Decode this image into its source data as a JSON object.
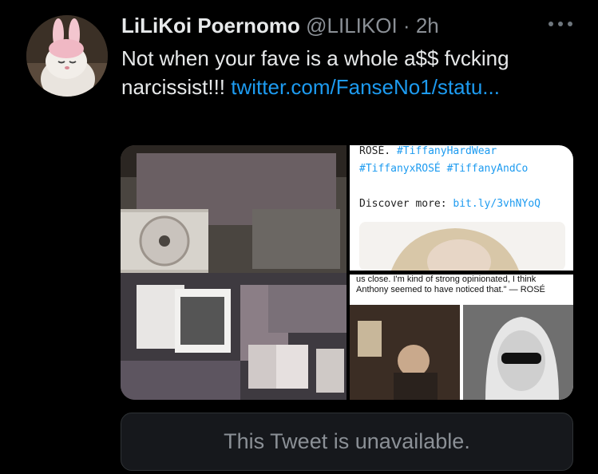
{
  "tweet": {
    "display_name": "LiLiKoi Poernomo",
    "handle": "@LILIKOI",
    "separator": "·",
    "time": "2h",
    "text": "Not when your fave is a whole a$$ fvcking narcissist!!!",
    "link_text": "twitter.com/FanseNo1/statu..."
  },
  "media": {
    "top_right": {
      "line1_prefix": "ROSÉ. ",
      "line1_tag": "#TiffanyHardWear",
      "line2": "#TiffanyxROSÉ #TiffanyAndCo",
      "discover_label": "Discover more: ",
      "discover_link": "bit.ly/3vhNYoQ"
    },
    "bottom_right": {
      "quote": "us close. I'm kind of strong opinionated, I think Anthony seemed to have noticed that.\" — ROSÉ"
    }
  },
  "quoted": {
    "unavailable_text": "This Tweet is unavailable."
  },
  "colors": {
    "background": "#000000",
    "link": "#1d9bf0",
    "secondary_text": "#8b9096"
  }
}
